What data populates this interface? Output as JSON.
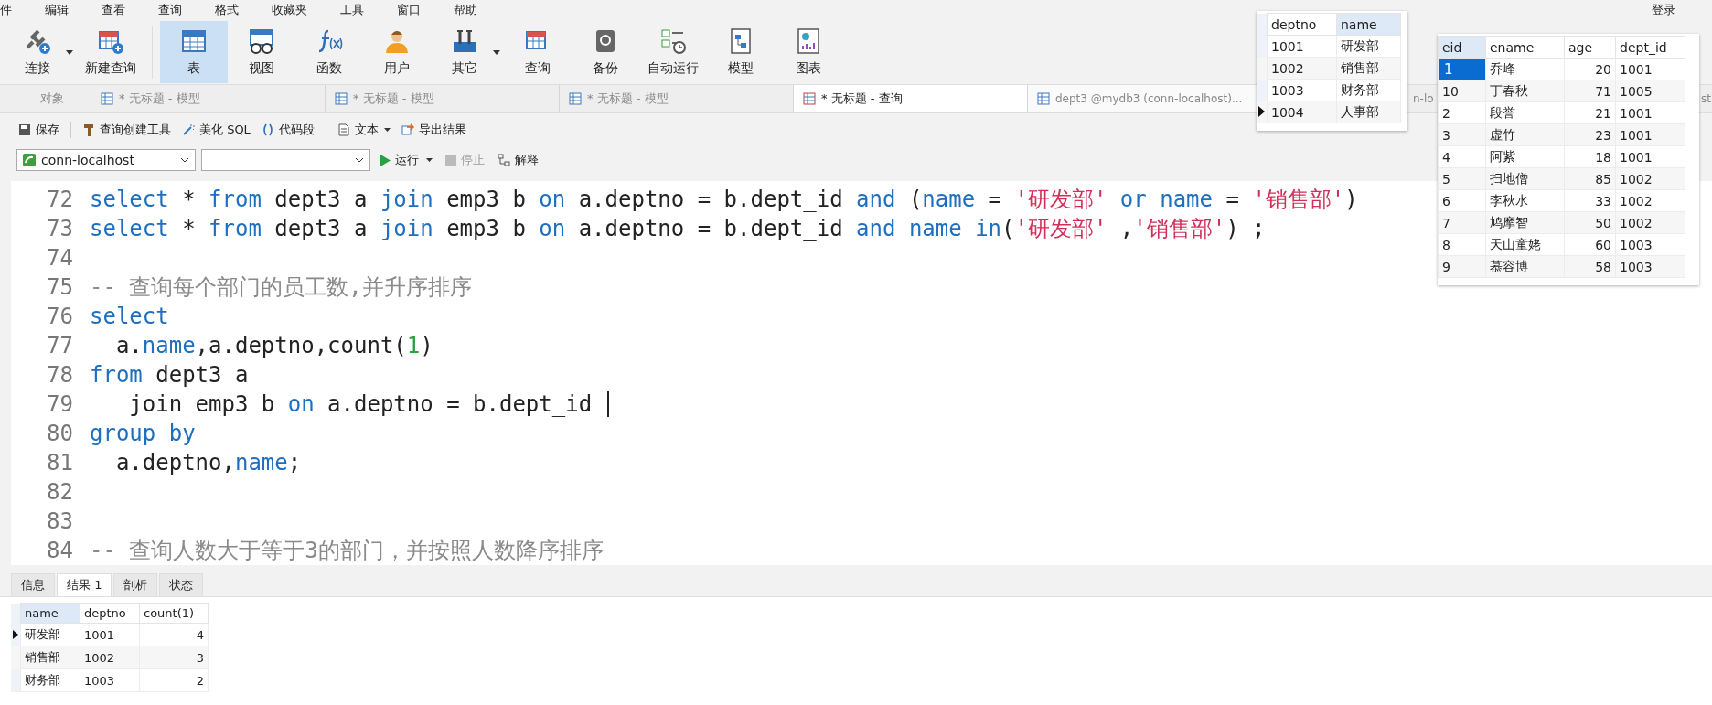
{
  "menu_bar": {
    "items": [
      "件",
      "编辑",
      "查看",
      "查询",
      "格式",
      "收藏夹",
      "工具",
      "窗口",
      "帮助"
    ],
    "login": "登录"
  },
  "toolbar": [
    {
      "label": "连接",
      "selected": false,
      "dropdown": true
    },
    {
      "label": "新建查询",
      "selected": false,
      "dropdown": false
    },
    {
      "label": "表",
      "selected": true,
      "dropdown": false
    },
    {
      "label": "视图",
      "selected": false,
      "dropdown": false
    },
    {
      "label": "函数",
      "selected": false,
      "dropdown": false
    },
    {
      "label": "用户",
      "selected": false,
      "dropdown": false
    },
    {
      "label": "其它",
      "selected": false,
      "dropdown": true
    },
    {
      "label": "查询",
      "selected": false,
      "dropdown": false
    },
    {
      "label": "备份",
      "selected": false,
      "dropdown": false
    },
    {
      "label": "自动运行",
      "selected": false,
      "dropdown": false
    },
    {
      "label": "模型",
      "selected": false,
      "dropdown": false
    },
    {
      "label": "图表",
      "selected": false,
      "dropdown": false
    }
  ],
  "tabs": [
    {
      "label": "对象",
      "selected": false
    },
    {
      "label": "* 无标题 - 模型",
      "selected": false
    },
    {
      "label": "* 无标题 - 模型",
      "selected": false
    },
    {
      "label": "* 无标题 - 模型",
      "selected": false
    },
    {
      "label": "* 无标题 - 查询",
      "selected": true
    },
    {
      "label": "dept3 @mydb3 (conn-localhost)...",
      "selected": false
    },
    {
      "label": "n-lo",
      "selected": false
    },
    {
      "label": "st",
      "selected": false
    }
  ],
  "editor_toolbar": [
    "保存",
    "查询创建工具",
    "美化 SQL",
    "代码段",
    "文本",
    "导出结果"
  ],
  "connection": {
    "value": "conn-localhost",
    "run": "运行",
    "stop": "停止",
    "stop_disabled": true,
    "explain": "解释"
  },
  "editor": {
    "lines": [
      {
        "number": "72",
        "tokens": [
          {
            "kind": "keyword",
            "text": "select"
          },
          {
            "kind": "plain",
            "text": " * "
          },
          {
            "kind": "keyword",
            "text": "from"
          },
          {
            "kind": "plain",
            "text": " dept3 a "
          },
          {
            "kind": "keyword",
            "text": "join"
          },
          {
            "kind": "plain",
            "text": " emp3 b "
          },
          {
            "kind": "keyword",
            "text": "on"
          },
          {
            "kind": "plain",
            "text": " a.deptno = b.dept_id "
          },
          {
            "kind": "keyword",
            "text": "and"
          },
          {
            "kind": "plain",
            "text": " ("
          },
          {
            "kind": "keyword",
            "text": "name"
          },
          {
            "kind": "plain",
            "text": " = "
          },
          {
            "kind": "string",
            "text": "'研发部'"
          },
          {
            "kind": "keyword",
            "text": " or name"
          },
          {
            "kind": "plain",
            "text": " = "
          },
          {
            "kind": "string",
            "text": "'销售部'"
          },
          {
            "kind": "plain",
            "text": ")"
          }
        ]
      },
      {
        "number": "73",
        "tokens": [
          {
            "kind": "keyword",
            "text": "select"
          },
          {
            "kind": "plain",
            "text": " * "
          },
          {
            "kind": "keyword",
            "text": "from"
          },
          {
            "kind": "plain",
            "text": " dept3 a "
          },
          {
            "kind": "keyword",
            "text": "join"
          },
          {
            "kind": "plain",
            "text": " emp3 b "
          },
          {
            "kind": "keyword",
            "text": "on"
          },
          {
            "kind": "plain",
            "text": " a.deptno = b.dept_id "
          },
          {
            "kind": "keyword",
            "text": "and name in"
          },
          {
            "kind": "plain",
            "text": "("
          },
          {
            "kind": "string",
            "text": "'研发部'"
          },
          {
            "kind": "plain",
            "text": " ,"
          },
          {
            "kind": "string",
            "text": "'销售部'"
          },
          {
            "kind": "plain",
            "text": ") ;"
          }
        ]
      },
      {
        "number": "74"
      },
      {
        "number": "75",
        "tokens": [
          {
            "kind": "comment",
            "text": "-- 查询每个部门的员工数,并升序排序"
          }
        ]
      },
      {
        "number": "76",
        "tokens": [
          {
            "kind": "keyword",
            "text": "select"
          }
        ]
      },
      {
        "number": "77",
        "tokens": [
          {
            "kind": "plain",
            "text": "  a."
          },
          {
            "kind": "keyword",
            "text": "name"
          },
          {
            "kind": "plain",
            "text": ",a.deptno,count("
          },
          {
            "kind": "number",
            "text": "1"
          },
          {
            "kind": "plain",
            "text": ")"
          }
        ]
      },
      {
        "number": "78",
        "tokens": [
          {
            "kind": "keyword",
            "text": "from"
          },
          {
            "kind": "plain",
            "text": " dept3 a"
          }
        ]
      },
      {
        "number": "79",
        "caret": true,
        "tokens": [
          {
            "kind": "plain",
            "text": "   join emp3 b "
          },
          {
            "kind": "keyword",
            "text": "on"
          },
          {
            "kind": "plain",
            "text": " a.deptno = b.dept_id "
          }
        ]
      },
      {
        "number": "80",
        "tokens": [
          {
            "kind": "keyword",
            "text": "group by"
          }
        ]
      },
      {
        "number": "81",
        "tokens": [
          {
            "kind": "plain",
            "text": "  a.deptno,"
          },
          {
            "kind": "keyword",
            "text": "name"
          },
          {
            "kind": "plain",
            "text": ";"
          }
        ]
      },
      {
        "number": "82"
      },
      {
        "number": "83"
      },
      {
        "number": "84",
        "tokens": [
          {
            "kind": "comment",
            "text": "-- 查询人数大于等于3的部门，并按照人数降序排序"
          }
        ]
      }
    ]
  },
  "result_tabs": [
    {
      "label": "信息",
      "selected": false
    },
    {
      "label": "结果 1",
      "selected": true
    },
    {
      "label": "剖析",
      "selected": false
    },
    {
      "label": "状态",
      "selected": false
    }
  ],
  "result_grid": {
    "columns": [
      "name",
      "deptno",
      "count(1)"
    ],
    "rows": [
      {
        "cells": [
          "研发部",
          "1001",
          "4"
        ],
        "current": true
      },
      {
        "cells": [
          "销售部",
          "1002",
          "3"
        ],
        "current": false
      },
      {
        "cells": [
          "财务部",
          "1003",
          "2"
        ],
        "current": false
      }
    ]
  },
  "dept_table": {
    "columns": [
      "deptno",
      "name"
    ],
    "rows": [
      {
        "cells": [
          "1001",
          "研发部"
        ],
        "current": false
      },
      {
        "cells": [
          "1002",
          "销售部"
        ],
        "current": false
      },
      {
        "cells": [
          "1003",
          "财务部"
        ],
        "current": false
      },
      {
        "cells": [
          "1004",
          "人事部"
        ],
        "current": true
      }
    ]
  },
  "emp_table": {
    "columns": [
      "eid",
      "ename",
      "age",
      "dept_id"
    ],
    "rows": [
      {
        "cells": [
          "1",
          "乔峰",
          "20",
          "1001"
        ],
        "selected": true
      },
      {
        "cells": [
          "10",
          "丁春秋",
          "71",
          "1005"
        ],
        "selected": false
      },
      {
        "cells": [
          "2",
          "段誉",
          "21",
          "1001"
        ],
        "selected": false
      },
      {
        "cells": [
          "3",
          "虚竹",
          "23",
          "1001"
        ],
        "selected": false
      },
      {
        "cells": [
          "4",
          "阿紫",
          "18",
          "1001"
        ],
        "selected": false
      },
      {
        "cells": [
          "5",
          "扫地僧",
          "85",
          "1002"
        ],
        "selected": false
      },
      {
        "cells": [
          "6",
          "李秋水",
          "33",
          "1002"
        ],
        "selected": false
      },
      {
        "cells": [
          "7",
          "鸠摩智",
          "50",
          "1002"
        ],
        "selected": false
      },
      {
        "cells": [
          "8",
          "天山童姥",
          "60",
          "1003"
        ],
        "selected": false
      },
      {
        "cells": [
          "9",
          "慕容博",
          "58",
          "1003"
        ],
        "selected": false
      }
    ]
  }
}
